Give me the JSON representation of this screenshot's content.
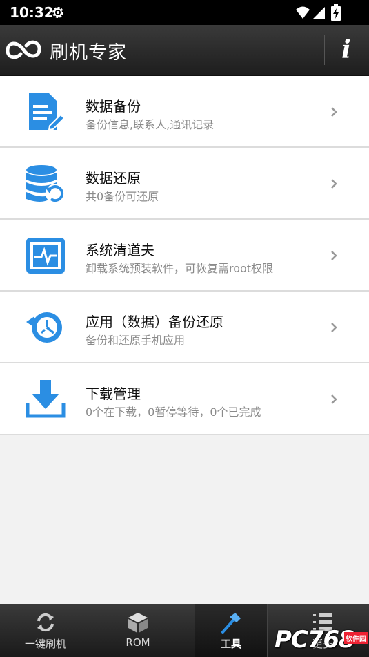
{
  "status_bar": {
    "time": "10:32"
  },
  "header": {
    "title": "刷机专家",
    "info_glyph": "i"
  },
  "tools": [
    {
      "title": "数据备份",
      "subtitle": "备份信息,联系人,通讯记录",
      "icon": "document-edit-icon"
    },
    {
      "title": "数据还原",
      "subtitle": "共0备份可还原",
      "icon": "database-restore-icon"
    },
    {
      "title": "系统清道夫",
      "subtitle": "卸载系统预装软件，可恢复需root权限",
      "icon": "monitor-pulse-icon"
    },
    {
      "title": "应用（数据）备份还原",
      "subtitle": "备份和还原手机应用",
      "icon": "restore-clock-icon"
    },
    {
      "title": "下载管理",
      "subtitle": "0个在下载，0暂停等待，0个已完成",
      "icon": "download-icon"
    }
  ],
  "nav": {
    "tabs": [
      {
        "label": "一键刷机",
        "icon": "refresh-icon"
      },
      {
        "label": "ROM",
        "icon": "box-icon"
      },
      {
        "label": "工具",
        "icon": "hammer-icon",
        "active": true
      },
      {
        "label": "更多",
        "icon": "list-icon"
      }
    ]
  },
  "watermark": {
    "text": "PC768",
    "tag": "软件园"
  },
  "colors": {
    "accent": "#2b8ee3",
    "header": "#2a2a2a"
  }
}
